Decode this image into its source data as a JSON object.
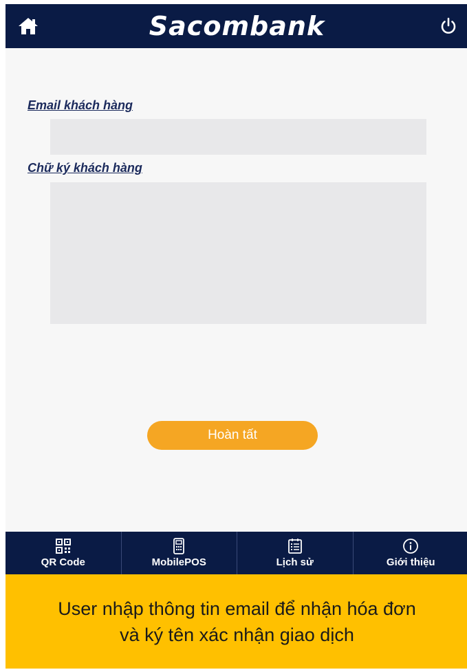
{
  "header": {
    "title": "Sacombank",
    "home_icon": "home-icon",
    "power_icon": "power-icon"
  },
  "form": {
    "email_label": "Email khách hàng",
    "email_value": "",
    "signature_label": "Chữ ký khách hàng",
    "submit_label": "Hoàn tất"
  },
  "bottom_nav": {
    "items": [
      {
        "label": "QR Code",
        "icon": "qr-code-icon"
      },
      {
        "label": "MobilePOS",
        "icon": "pos-terminal-icon"
      },
      {
        "label": "Lịch sử",
        "icon": "history-list-icon"
      },
      {
        "label": "Giới thiệu",
        "icon": "info-icon"
      }
    ]
  },
  "caption": {
    "line1": "User nhập thông tin email để nhận hóa đơn",
    "line2": "và ký tên xác nhận giao dịch"
  },
  "colors": {
    "brand_navy": "#0a1b45",
    "accent_orange": "#f5a623",
    "caption_yellow": "#ffc000"
  }
}
